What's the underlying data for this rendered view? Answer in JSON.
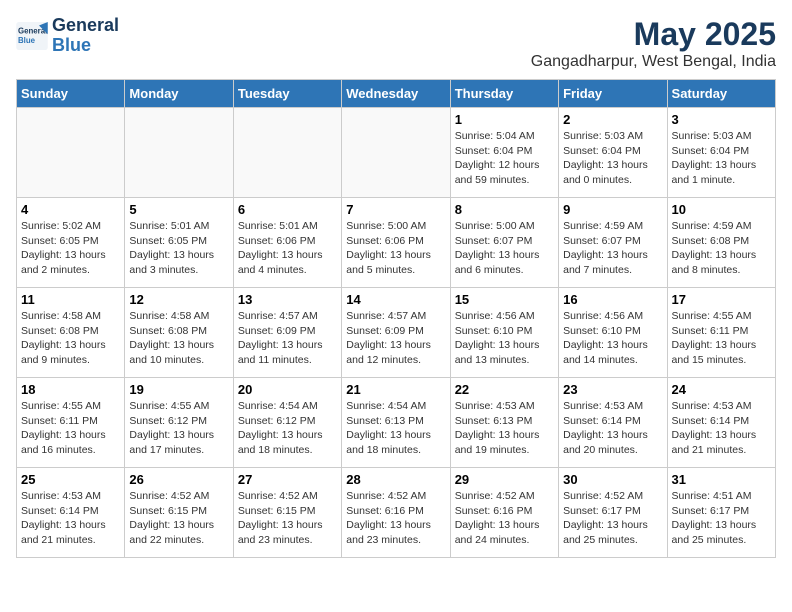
{
  "logo": {
    "line1": "General",
    "line2": "Blue"
  },
  "title": "May 2025",
  "location": "Gangadharpur, West Bengal, India",
  "weekdays": [
    "Sunday",
    "Monday",
    "Tuesday",
    "Wednesday",
    "Thursday",
    "Friday",
    "Saturday"
  ],
  "weeks": [
    [
      {
        "day": "",
        "info": ""
      },
      {
        "day": "",
        "info": ""
      },
      {
        "day": "",
        "info": ""
      },
      {
        "day": "",
        "info": ""
      },
      {
        "day": "1",
        "info": "Sunrise: 5:04 AM\nSunset: 6:04 PM\nDaylight: 12 hours\nand 59 minutes."
      },
      {
        "day": "2",
        "info": "Sunrise: 5:03 AM\nSunset: 6:04 PM\nDaylight: 13 hours\nand 0 minutes."
      },
      {
        "day": "3",
        "info": "Sunrise: 5:03 AM\nSunset: 6:04 PM\nDaylight: 13 hours\nand 1 minute."
      }
    ],
    [
      {
        "day": "4",
        "info": "Sunrise: 5:02 AM\nSunset: 6:05 PM\nDaylight: 13 hours\nand 2 minutes."
      },
      {
        "day": "5",
        "info": "Sunrise: 5:01 AM\nSunset: 6:05 PM\nDaylight: 13 hours\nand 3 minutes."
      },
      {
        "day": "6",
        "info": "Sunrise: 5:01 AM\nSunset: 6:06 PM\nDaylight: 13 hours\nand 4 minutes."
      },
      {
        "day": "7",
        "info": "Sunrise: 5:00 AM\nSunset: 6:06 PM\nDaylight: 13 hours\nand 5 minutes."
      },
      {
        "day": "8",
        "info": "Sunrise: 5:00 AM\nSunset: 6:07 PM\nDaylight: 13 hours\nand 6 minutes."
      },
      {
        "day": "9",
        "info": "Sunrise: 4:59 AM\nSunset: 6:07 PM\nDaylight: 13 hours\nand 7 minutes."
      },
      {
        "day": "10",
        "info": "Sunrise: 4:59 AM\nSunset: 6:08 PM\nDaylight: 13 hours\nand 8 minutes."
      }
    ],
    [
      {
        "day": "11",
        "info": "Sunrise: 4:58 AM\nSunset: 6:08 PM\nDaylight: 13 hours\nand 9 minutes."
      },
      {
        "day": "12",
        "info": "Sunrise: 4:58 AM\nSunset: 6:08 PM\nDaylight: 13 hours\nand 10 minutes."
      },
      {
        "day": "13",
        "info": "Sunrise: 4:57 AM\nSunset: 6:09 PM\nDaylight: 13 hours\nand 11 minutes."
      },
      {
        "day": "14",
        "info": "Sunrise: 4:57 AM\nSunset: 6:09 PM\nDaylight: 13 hours\nand 12 minutes."
      },
      {
        "day": "15",
        "info": "Sunrise: 4:56 AM\nSunset: 6:10 PM\nDaylight: 13 hours\nand 13 minutes."
      },
      {
        "day": "16",
        "info": "Sunrise: 4:56 AM\nSunset: 6:10 PM\nDaylight: 13 hours\nand 14 minutes."
      },
      {
        "day": "17",
        "info": "Sunrise: 4:55 AM\nSunset: 6:11 PM\nDaylight: 13 hours\nand 15 minutes."
      }
    ],
    [
      {
        "day": "18",
        "info": "Sunrise: 4:55 AM\nSunset: 6:11 PM\nDaylight: 13 hours\nand 16 minutes."
      },
      {
        "day": "19",
        "info": "Sunrise: 4:55 AM\nSunset: 6:12 PM\nDaylight: 13 hours\nand 17 minutes."
      },
      {
        "day": "20",
        "info": "Sunrise: 4:54 AM\nSunset: 6:12 PM\nDaylight: 13 hours\nand 18 minutes."
      },
      {
        "day": "21",
        "info": "Sunrise: 4:54 AM\nSunset: 6:13 PM\nDaylight: 13 hours\nand 18 minutes."
      },
      {
        "day": "22",
        "info": "Sunrise: 4:53 AM\nSunset: 6:13 PM\nDaylight: 13 hours\nand 19 minutes."
      },
      {
        "day": "23",
        "info": "Sunrise: 4:53 AM\nSunset: 6:14 PM\nDaylight: 13 hours\nand 20 minutes."
      },
      {
        "day": "24",
        "info": "Sunrise: 4:53 AM\nSunset: 6:14 PM\nDaylight: 13 hours\nand 21 minutes."
      }
    ],
    [
      {
        "day": "25",
        "info": "Sunrise: 4:53 AM\nSunset: 6:14 PM\nDaylight: 13 hours\nand 21 minutes."
      },
      {
        "day": "26",
        "info": "Sunrise: 4:52 AM\nSunset: 6:15 PM\nDaylight: 13 hours\nand 22 minutes."
      },
      {
        "day": "27",
        "info": "Sunrise: 4:52 AM\nSunset: 6:15 PM\nDaylight: 13 hours\nand 23 minutes."
      },
      {
        "day": "28",
        "info": "Sunrise: 4:52 AM\nSunset: 6:16 PM\nDaylight: 13 hours\nand 23 minutes."
      },
      {
        "day": "29",
        "info": "Sunrise: 4:52 AM\nSunset: 6:16 PM\nDaylight: 13 hours\nand 24 minutes."
      },
      {
        "day": "30",
        "info": "Sunrise: 4:52 AM\nSunset: 6:17 PM\nDaylight: 13 hours\nand 25 minutes."
      },
      {
        "day": "31",
        "info": "Sunrise: 4:51 AM\nSunset: 6:17 PM\nDaylight: 13 hours\nand 25 minutes."
      }
    ]
  ]
}
